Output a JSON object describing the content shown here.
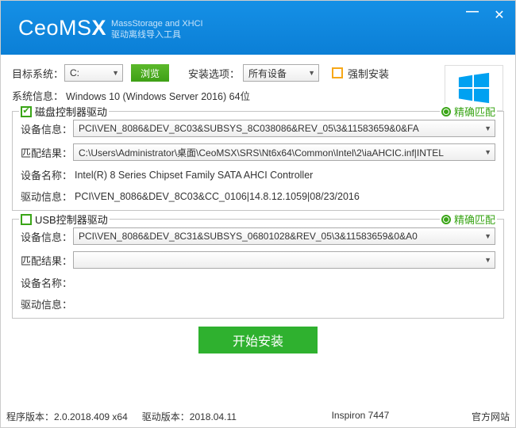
{
  "header": {
    "logo_main": "CeoMS",
    "logo_accent": "X",
    "sub1": "MassStorage and XHCI",
    "sub2": "驱动离线导入工具"
  },
  "target": {
    "label": "目标系统：",
    "drive": "C:",
    "browse": "浏览",
    "install_opt_label": "安装选项：",
    "install_opt_value": "所有设备",
    "force_label": "强制安装"
  },
  "sysinfo": {
    "label": "系统信息：",
    "value": "Windows 10 (Windows Server 2016)    64位"
  },
  "group1": {
    "title": "磁盘控制器驱动",
    "match": "精确匹配",
    "dev_label": "设备信息：",
    "dev_value": "PCI\\VEN_8086&DEV_8C03&SUBSYS_8C038086&REV_05\\3&11583659&0&FA",
    "match_label": "匹配结果：",
    "match_value": "C:\\Users\\Administrator\\桌面\\CeoMSX\\SRS\\Nt6x64\\Common\\Intel\\2\\iaAHCIC.inf|INTEL",
    "name_label": "设备名称：",
    "name_value": "Intel(R) 8 Series Chipset Family SATA AHCI Controller",
    "drv_label": "驱动信息：",
    "drv_value": "PCI\\VEN_8086&DEV_8C03&CC_0106|14.8.12.1059|08/23/2016"
  },
  "group2": {
    "title": "USB控制器驱动",
    "match": "精确匹配",
    "dev_label": "设备信息：",
    "dev_value": "PCI\\VEN_8086&DEV_8C31&SUBSYS_06801028&REV_05\\3&11583659&0&A0",
    "match_label": "匹配结果：",
    "match_value": "",
    "name_label": "设备名称：",
    "name_value": "",
    "drv_label": "驱动信息：",
    "drv_value": ""
  },
  "install_button": "开始安装",
  "footer": {
    "prog_ver_label": "程序版本：",
    "prog_ver": "2.0.2018.409 x64",
    "drv_ver_label": "驱动版本：",
    "drv_ver": "2018.04.11",
    "model": "Inspiron 7447",
    "site": "官方网站"
  }
}
